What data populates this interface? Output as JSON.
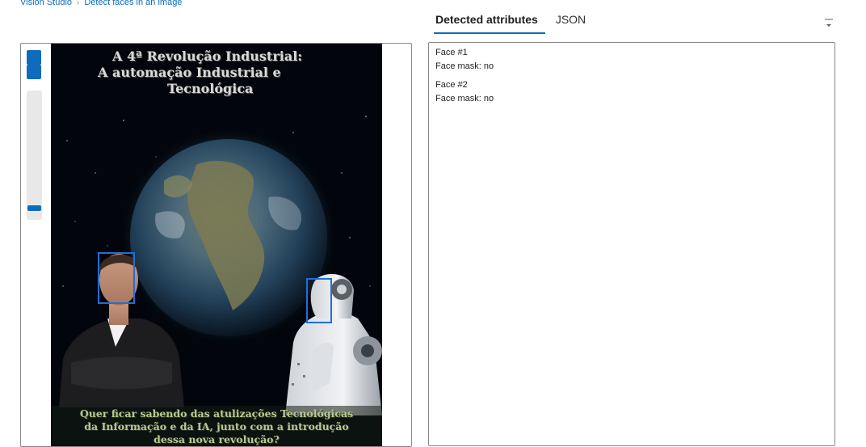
{
  "breadcrumb": {
    "root": "Vision Studio",
    "current": "Detect faces in an image"
  },
  "tabs": [
    {
      "label": "Detected attributes",
      "active": true
    },
    {
      "label": "JSON",
      "active": false
    }
  ],
  "image": {
    "title_lines": [
      "A 4ª Revolução Industrial:",
      "A automação Industrial e",
      "Tecnológica"
    ],
    "footer_lines": [
      "Quer ficar sabendo das atulizações Tecnológicas",
      "da Informação e da IA, junto com a introdução",
      "dessa nova revolução?"
    ]
  },
  "results": {
    "faces": [
      {
        "name": "Face #1",
        "attribute": "Face mask: no"
      },
      {
        "name": "Face #2",
        "attribute": "Face mask: no"
      }
    ]
  },
  "colors": {
    "accent": "#0f6cbd",
    "face_box": "#1e6fd9"
  }
}
